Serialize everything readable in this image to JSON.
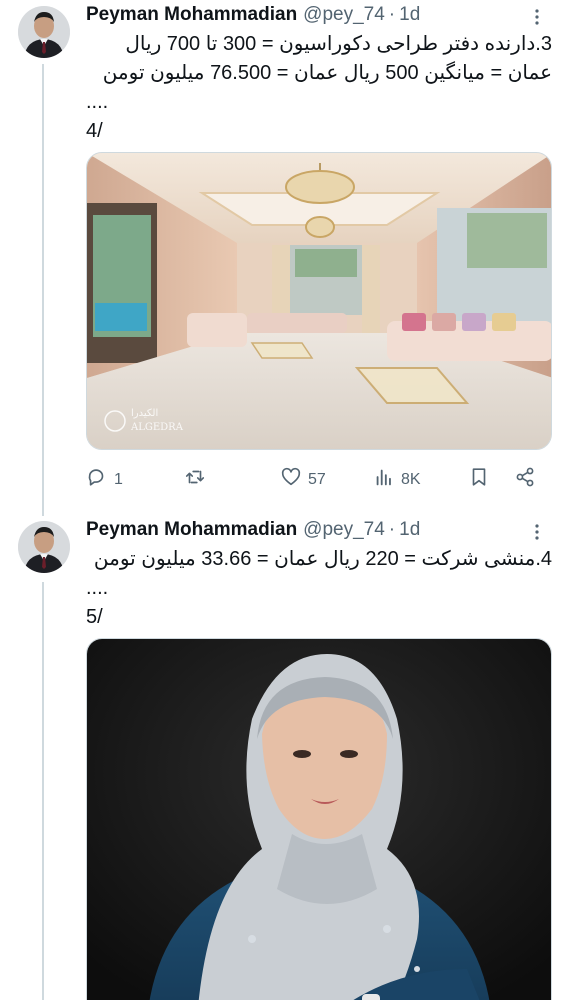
{
  "tweets": [
    {
      "author": {
        "name": "Peyman Mohammadian",
        "handle": "@pey_74",
        "time": "1d"
      },
      "text_lines": [
        "3.دارنده دفتر طراحی دکوراسیون = 300 تا 700 ریال",
        "عمان = میانگین 500 ریال عمان = 76.500 میلیون تومن",
        "....",
        "4/"
      ],
      "media": {
        "watermark_en": "ALGEDRA",
        "watermark_ar": "الكيدرا"
      },
      "actions": {
        "replies": "1",
        "retweets": "",
        "likes": "57",
        "views": "8K"
      }
    },
    {
      "author": {
        "name": "Peyman Mohammadian",
        "handle": "@pey_74",
        "time": "1d"
      },
      "text_lines": [
        "4.منشی شرکت = 220 ریال عمان = 33.66 میلیون تومن",
        "....",
        "5/"
      ]
    }
  ],
  "icons": {
    "more": "more-icon",
    "reply": "reply-icon",
    "retweet": "retweet-icon",
    "like": "heart-icon",
    "views": "views-icon",
    "bookmark": "bookmark-icon",
    "share": "share-icon"
  },
  "colors": {
    "text": "#0f1419",
    "secondary": "#536471",
    "border": "#cfd9de"
  }
}
